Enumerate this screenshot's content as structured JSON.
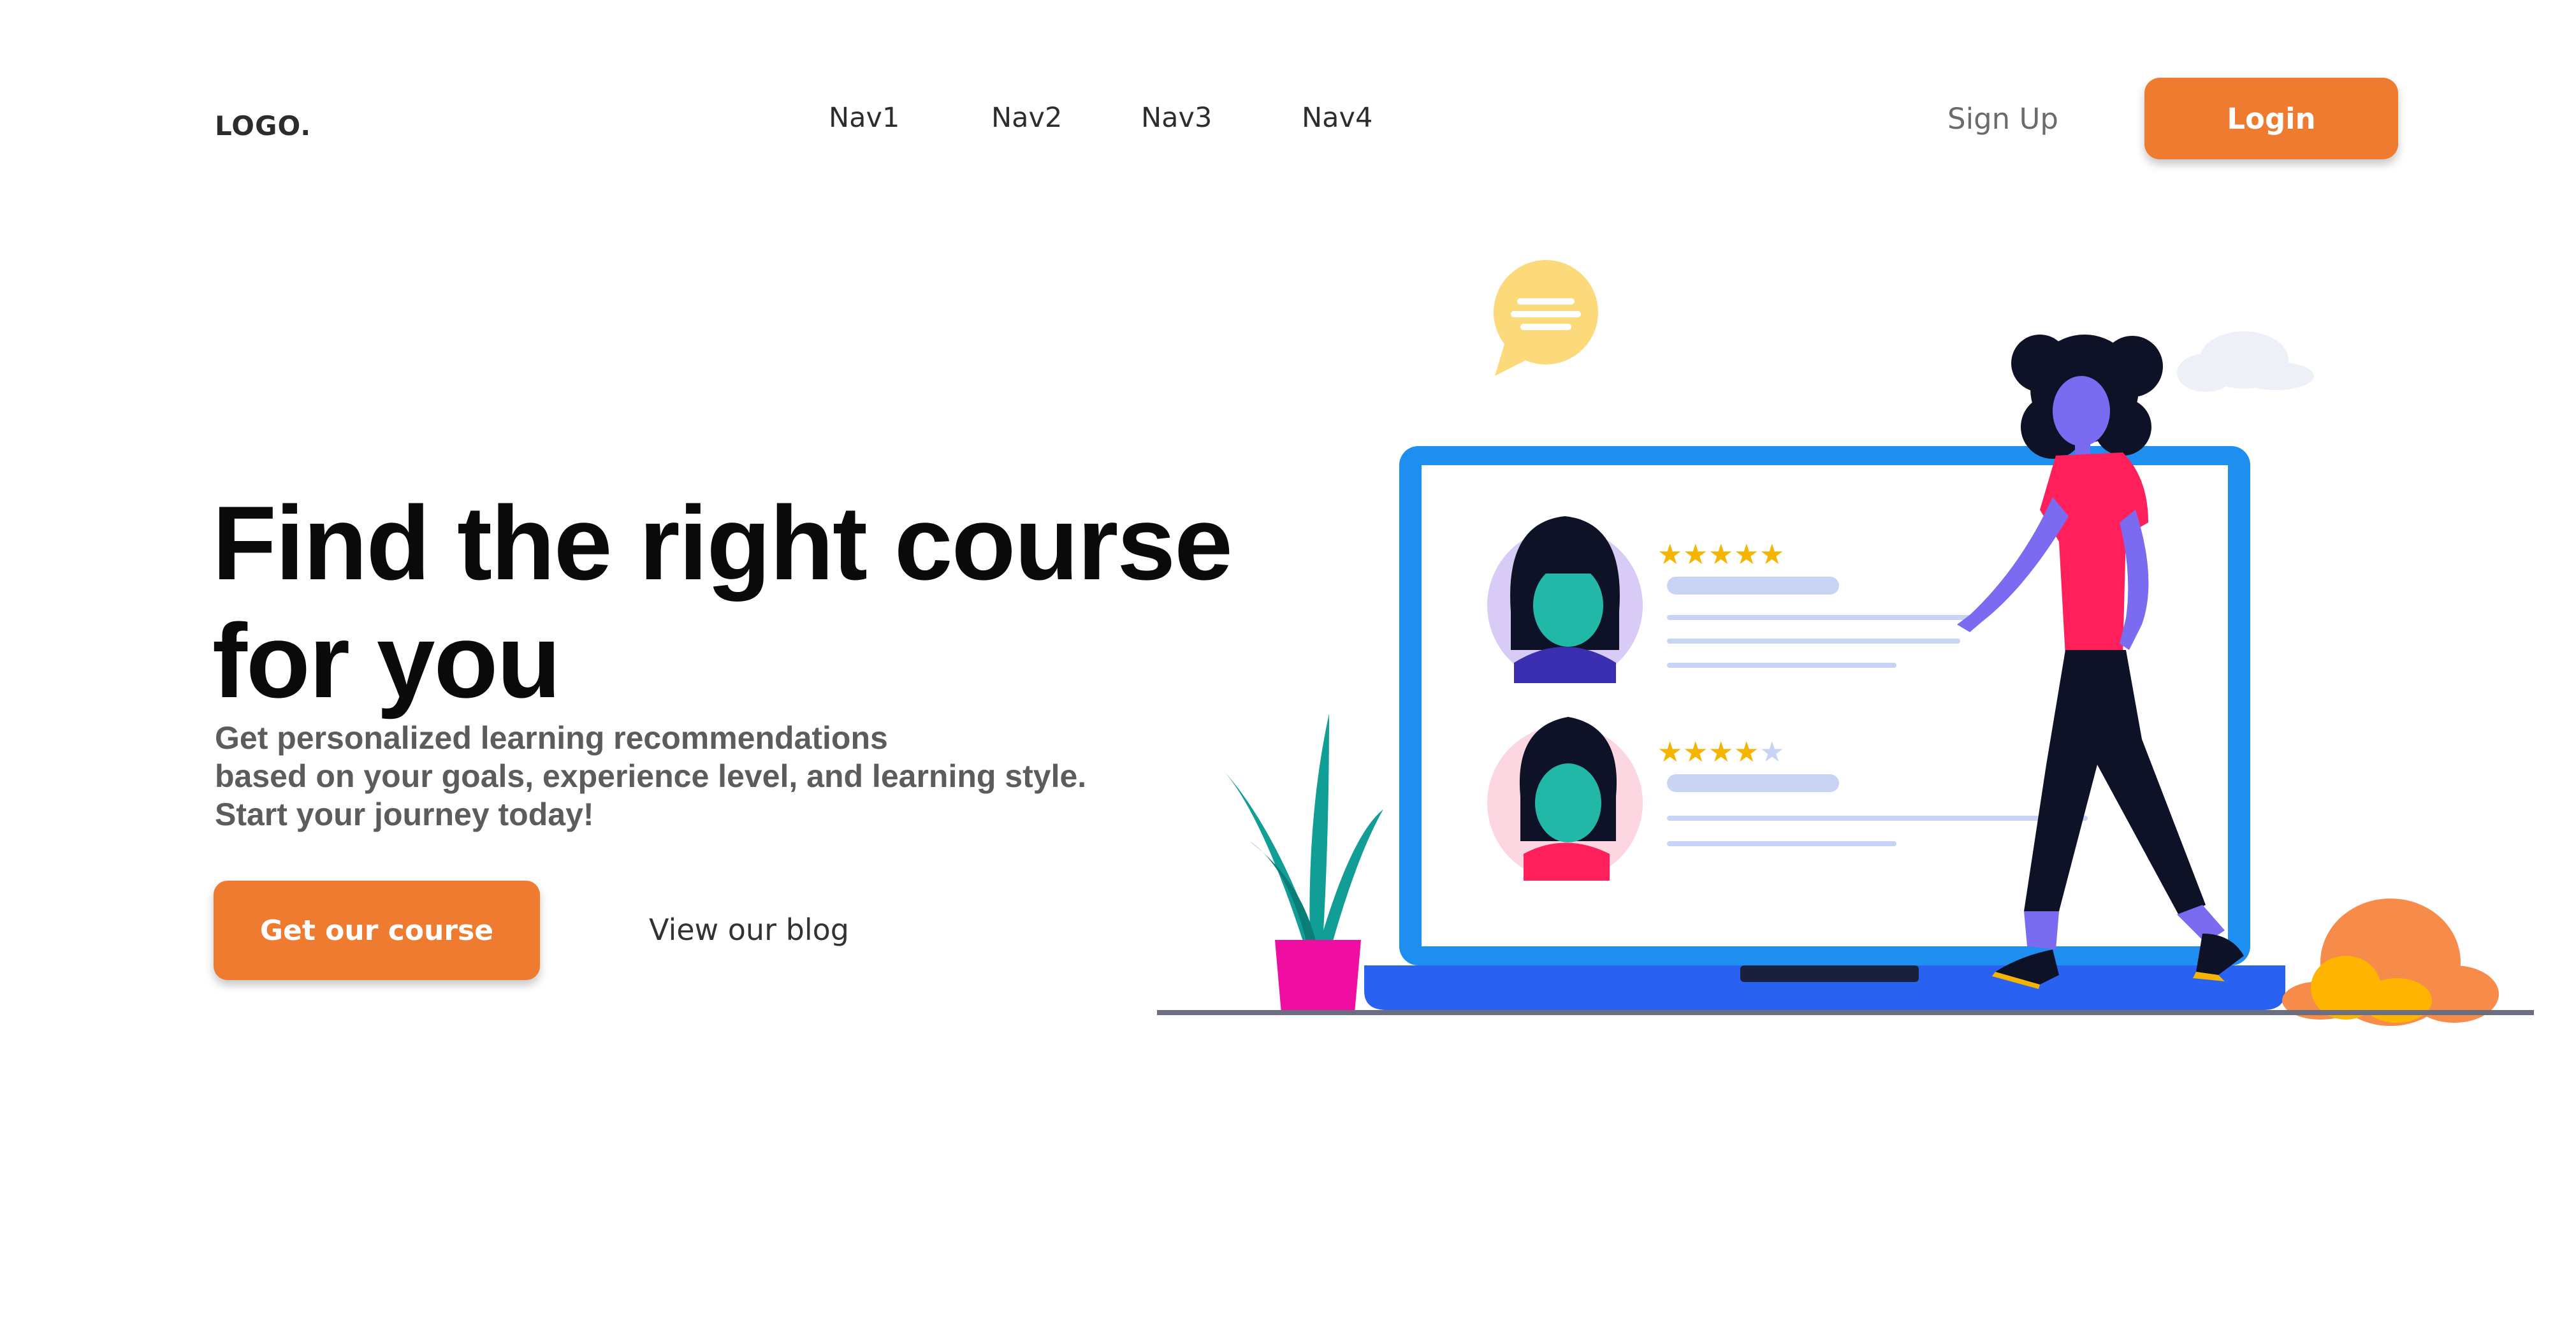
{
  "header": {
    "logo": "LOGO.",
    "nav": [
      {
        "label": "Nav1"
      },
      {
        "label": "Nav2"
      },
      {
        "label": "Nav3"
      },
      {
        "label": "Nav4"
      }
    ],
    "signup_label": "Sign Up",
    "login_label": "Login"
  },
  "hero": {
    "title_line1": "Find the right course",
    "title_line2": "for you",
    "subtitle_lines": [
      "Get personalized learning recommendations",
      "based on your goals, experience level, and learning style.",
      "Start your journey today!"
    ],
    "cta_label": "Get our course",
    "blog_label": "View our blog"
  },
  "illustration": {
    "reviews": [
      {
        "stars_filled": 5,
        "stars_total": 5
      },
      {
        "stars_filled": 4,
        "stars_total": 5
      }
    ]
  },
  "colors": {
    "accent": "#ee7b30",
    "laptop": "#1e8ff0",
    "laptop_base": "#2962f0",
    "star": "#f5b400",
    "shirt": "#ff1f5a",
    "skin": "#7a6bf0"
  }
}
